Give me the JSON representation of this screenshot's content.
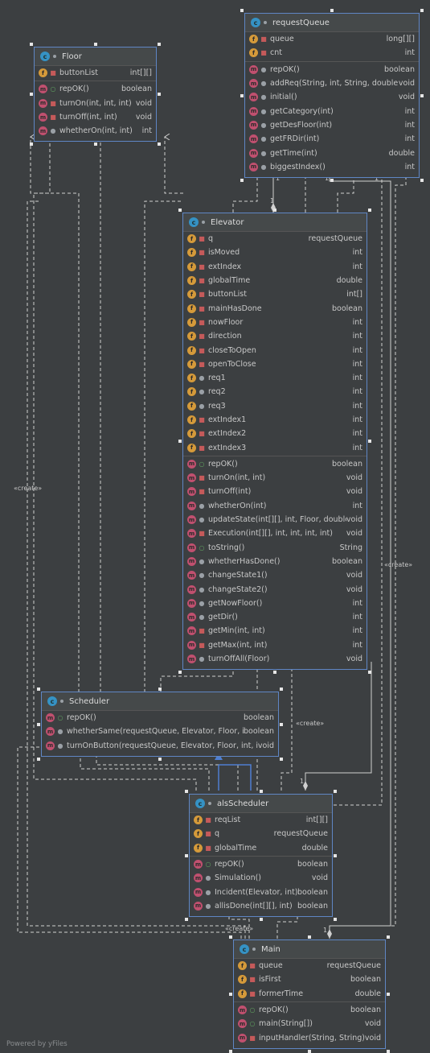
{
  "classes": {
    "floor": {
      "name": "Floor",
      "fields": [
        {
          "vis": "priv",
          "name": "buttonList",
          "type": "int[][]"
        }
      ],
      "methods": [
        {
          "vis": "pub",
          "name": "repOK()",
          "type": "boolean"
        },
        {
          "vis": "priv",
          "name": "turnOn(int, int, int)",
          "type": "void"
        },
        {
          "vis": "priv",
          "name": "turnOff(int, int)",
          "type": "void"
        },
        {
          "vis": "pkg",
          "name": "whetherOn(int, int)",
          "type": "int"
        }
      ]
    },
    "requestQueue": {
      "name": "requestQueue",
      "fields": [
        {
          "vis": "priv",
          "name": "queue",
          "type": "long[][]"
        },
        {
          "vis": "priv",
          "name": "cnt",
          "type": "int"
        }
      ],
      "methods": [
        {
          "vis": "pkg",
          "name": "repOK()",
          "type": "boolean"
        },
        {
          "vis": "pkg",
          "name": "addReq(String, int, String, double)",
          "type": "void"
        },
        {
          "vis": "pkg",
          "name": "initial()",
          "type": "void"
        },
        {
          "vis": "pkg",
          "name": "getCategory(int)",
          "type": "int"
        },
        {
          "vis": "pkg",
          "name": "getDesFloor(int)",
          "type": "int"
        },
        {
          "vis": "pkg",
          "name": "getFRDir(int)",
          "type": "int"
        },
        {
          "vis": "pkg",
          "name": "getTime(int)",
          "type": "double"
        },
        {
          "vis": "pkg",
          "name": "biggestIndex()",
          "type": "int"
        }
      ]
    },
    "elevator": {
      "name": "Elevator",
      "fields": [
        {
          "vis": "priv",
          "name": "q",
          "type": "requestQueue"
        },
        {
          "vis": "priv",
          "name": "isMoved",
          "type": "int"
        },
        {
          "vis": "priv",
          "name": "extIndex",
          "type": "int"
        },
        {
          "vis": "priv",
          "name": "globalTime",
          "type": "double"
        },
        {
          "vis": "priv",
          "name": "buttonList",
          "type": "int[]"
        },
        {
          "vis": "priv",
          "name": "mainHasDone",
          "type": "boolean"
        },
        {
          "vis": "priv",
          "name": "nowFloor",
          "type": "int"
        },
        {
          "vis": "priv",
          "name": "direction",
          "type": "int"
        },
        {
          "vis": "priv",
          "name": "closeToOpen",
          "type": "int"
        },
        {
          "vis": "priv",
          "name": "openToClose",
          "type": "int"
        },
        {
          "vis": "pkg",
          "name": "req1",
          "type": "int"
        },
        {
          "vis": "pkg",
          "name": "req2",
          "type": "int"
        },
        {
          "vis": "pkg",
          "name": "req3",
          "type": "int"
        },
        {
          "vis": "priv",
          "name": "extIndex1",
          "type": "int"
        },
        {
          "vis": "priv",
          "name": "extIndex2",
          "type": "int"
        },
        {
          "vis": "priv",
          "name": "extIndex3",
          "type": "int"
        }
      ],
      "methods": [
        {
          "vis": "pub",
          "name": "repOK()",
          "type": "boolean"
        },
        {
          "vis": "priv",
          "name": "turnOn(int, int)",
          "type": "void"
        },
        {
          "vis": "priv",
          "name": "turnOff(int)",
          "type": "void"
        },
        {
          "vis": "pkg",
          "name": "whetherOn(int)",
          "type": "int"
        },
        {
          "vis": "pkg",
          "name": "updateState(int[][], int, Floor, double)",
          "type": "void"
        },
        {
          "vis": "priv",
          "name": "Execution(int[][], int, int, int, int)",
          "type": "void"
        },
        {
          "vis": "pub",
          "name": "toString()",
          "type": "String"
        },
        {
          "vis": "pkg",
          "name": "whetherHasDone()",
          "type": "boolean"
        },
        {
          "vis": "pkg",
          "name": "changeState1()",
          "type": "void"
        },
        {
          "vis": "pkg",
          "name": "changeState2()",
          "type": "void"
        },
        {
          "vis": "pkg",
          "name": "getNowFloor()",
          "type": "int"
        },
        {
          "vis": "pkg",
          "name": "getDir()",
          "type": "int"
        },
        {
          "vis": "priv",
          "name": "getMin(int, int)",
          "type": "int"
        },
        {
          "vis": "priv",
          "name": "getMax(int, int)",
          "type": "int"
        },
        {
          "vis": "pkg",
          "name": "turnOffAll(Floor)",
          "type": "void"
        }
      ]
    },
    "scheduler": {
      "name": "Scheduler",
      "fields": [],
      "methods": [
        {
          "vis": "pub",
          "name": "repOK()",
          "type": "boolean"
        },
        {
          "vis": "pkg",
          "name": "whetherSame(requestQueue, Elevator, Floor, int)",
          "type": "boolean"
        },
        {
          "vis": "pkg",
          "name": "turnOnButton(requestQueue, Elevator, Floor, int, int)",
          "type": "void"
        }
      ]
    },
    "alsScheduler": {
      "name": "alsScheduler",
      "fields": [
        {
          "vis": "priv",
          "name": "reqList",
          "type": "int[][]"
        },
        {
          "vis": "priv",
          "name": "q",
          "type": "requestQueue"
        },
        {
          "vis": "priv",
          "name": "globalTime",
          "type": "double"
        }
      ],
      "methods": [
        {
          "vis": "pub",
          "name": "repOK()",
          "type": "boolean"
        },
        {
          "vis": "pkg",
          "name": "Simulation()",
          "type": "void"
        },
        {
          "vis": "pkg",
          "name": "Incident(Elevator, int)",
          "type": "boolean"
        },
        {
          "vis": "pkg",
          "name": "allisDone(int[][], int)",
          "type": "boolean"
        }
      ]
    },
    "main": {
      "name": "Main",
      "fields": [
        {
          "vis": "priv",
          "name": "queue",
          "type": "requestQueue"
        },
        {
          "vis": "priv",
          "name": "isFirst",
          "type": "boolean"
        },
        {
          "vis": "priv",
          "name": "formerTime",
          "type": "double"
        }
      ],
      "methods": [
        {
          "vis": "pub",
          "name": "repOK()",
          "type": "boolean"
        },
        {
          "vis": "pub",
          "name": "main(String[])",
          "type": "void"
        },
        {
          "vis": "priv",
          "name": "inputHandler(String, String)",
          "type": "void"
        }
      ]
    }
  },
  "labels": {
    "create": "«create»",
    "one": "1"
  },
  "colors": {
    "background": "#3c3f41",
    "border": "#5f86c4",
    "edge": "#d0d0d0",
    "inherit": "#4f7fd1"
  },
  "footer": "Powered by yFiles"
}
